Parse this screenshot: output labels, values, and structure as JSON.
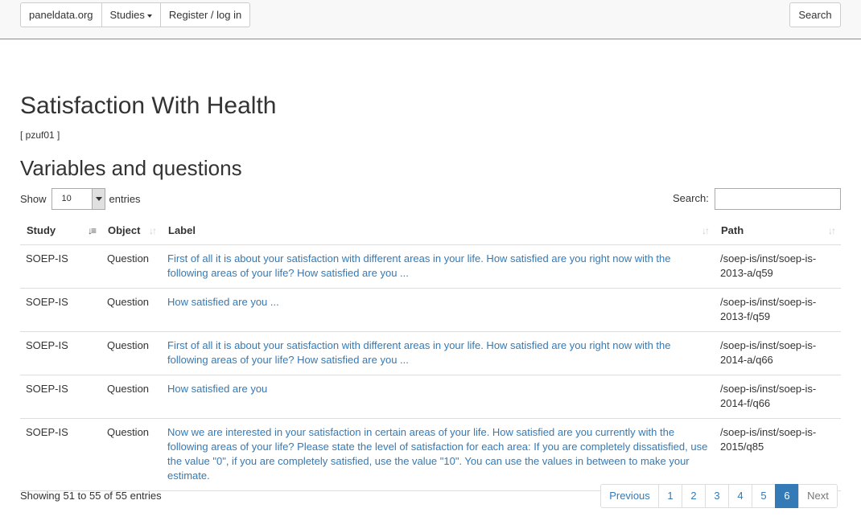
{
  "nav": {
    "brand": "paneldata.org",
    "studies": "Studies",
    "register": "Register / log in",
    "search": "Search"
  },
  "page": {
    "title": "Satisfaction With Health",
    "code": "[ pzuf01 ]",
    "section_title": "Variables and questions"
  },
  "controls": {
    "show": "Show",
    "length_value": "10",
    "entries": "entries",
    "search_label": "Search:"
  },
  "table": {
    "headers": [
      "Study",
      "Object",
      "Label",
      "Path"
    ],
    "rows": [
      {
        "study": "SOEP-IS",
        "object": "Question",
        "label": "First of all it is about your satisfaction with different areas in your life. How satisfied are you right now with the following areas of your life? How satisfied are you ...",
        "path": "/soep-is/inst/soep-is-2013-a/q59"
      },
      {
        "study": "SOEP-IS",
        "object": "Question",
        "label": "How satisfied are you ...",
        "path": "/soep-is/inst/soep-is-2013-f/q59"
      },
      {
        "study": "SOEP-IS",
        "object": "Question",
        "label": "First of all it is about your satisfaction with different areas in your life. How satisfied are you right now with the following areas of your life? How satisfied are you ...",
        "path": "/soep-is/inst/soep-is-2014-a/q66"
      },
      {
        "study": "SOEP-IS",
        "object": "Question",
        "label": "How satisfied are you",
        "path": "/soep-is/inst/soep-is-2014-f/q66"
      },
      {
        "study": "SOEP-IS",
        "object": "Question",
        "label": "Now we are interested in your satisfaction in certain areas of your life. How satisfied are you currently with the following areas of your life? Please state the level of satisfaction for each area: If you are completely dissatisfied, use the value \"0\", if you are completely satisfied, use the value \"10\". You can use the values in between to make your estimate.",
        "path": "/soep-is/inst/soep-is-2015/q85"
      }
    ]
  },
  "footer": {
    "info": "Showing 51 to 55 of 55 entries",
    "previous": "Previous",
    "pages": [
      "1",
      "2",
      "3",
      "4",
      "5",
      "6"
    ],
    "active_page": "6",
    "next": "Next"
  },
  "colors": {
    "link": "#337ab7",
    "active_page_bg": "#337ab7",
    "navbar_bg": "#f8f8f8"
  }
}
